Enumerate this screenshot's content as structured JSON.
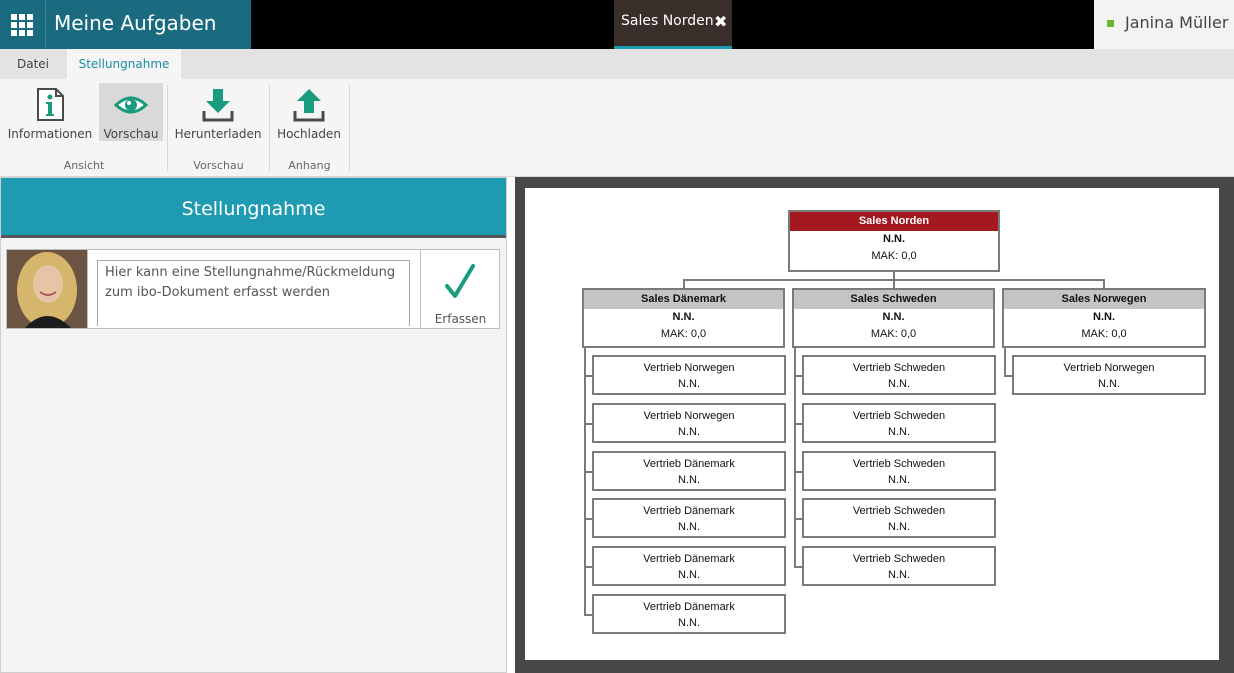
{
  "app": {
    "title": "Meine Aufgaben",
    "user": "Janina Müller",
    "status_color": "#6ab82e"
  },
  "document_tab": {
    "label": "Sales Norden",
    "close": "✖"
  },
  "ribbon_tabs": [
    {
      "label": "Datei",
      "active": false
    },
    {
      "label": "Stellungnahme",
      "active": true
    }
  ],
  "ribbon": {
    "buttons": [
      {
        "label": "Informationen",
        "icon": "info-icon",
        "selected": false
      },
      {
        "label": "Vorschau",
        "icon": "eye-icon",
        "selected": true
      },
      {
        "label": "Herunterladen",
        "icon": "download-icon",
        "selected": false
      },
      {
        "label": "Hochladen",
        "icon": "upload-icon",
        "selected": false
      }
    ],
    "groups": [
      "Ansicht",
      "Vorschau",
      "Anhang"
    ]
  },
  "stellungnahme": {
    "title": "Stellungnahme",
    "placeholder": "Hier kann eine Stellungnahme/Rückmeldung zum ibo-Dokument erfasst werden",
    "submit_label": "Erfassen",
    "submit_icon": "checkmark-icon"
  },
  "org_chart": {
    "root": {
      "name": "Sales Norden",
      "holder": "N.N.",
      "mak": "MAK: 0,0"
    },
    "regions": [
      {
        "name": "Sales Dänemark",
        "holder": "N.N.",
        "mak": "MAK: 0,0",
        "units": [
          {
            "name": "Vertrieb Norwegen",
            "holder": "N.N."
          },
          {
            "name": "Vertrieb Norwegen",
            "holder": "N.N."
          },
          {
            "name": "Vertrieb Dänemark",
            "holder": "N.N."
          },
          {
            "name": "Vertrieb Dänemark",
            "holder": "N.N."
          },
          {
            "name": "Vertrieb Dänemark",
            "holder": "N.N."
          },
          {
            "name": "Vertrieb Dänemark",
            "holder": "N.N."
          }
        ]
      },
      {
        "name": "Sales Schweden",
        "holder": "N.N.",
        "mak": "MAK: 0,0",
        "units": [
          {
            "name": "Vertrieb Schweden",
            "holder": "N.N."
          },
          {
            "name": "Vertrieb Schweden",
            "holder": "N.N."
          },
          {
            "name": "Vertrieb Schweden",
            "holder": "N.N."
          },
          {
            "name": "Vertrieb Schweden",
            "holder": "N.N."
          },
          {
            "name": "Vertrieb Schweden",
            "holder": "N.N."
          }
        ]
      },
      {
        "name": "Sales Norwegen",
        "holder": "N.N.",
        "mak": "MAK: 0,0",
        "units": [
          {
            "name": "Vertrieb Norwegen",
            "holder": "N.N."
          }
        ]
      }
    ]
  }
}
